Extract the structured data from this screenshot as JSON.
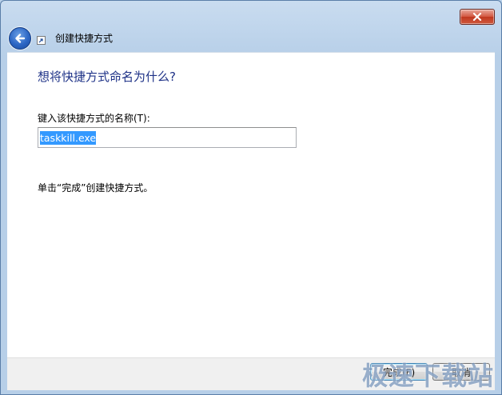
{
  "window": {
    "title": "创建快捷方式"
  },
  "nav": {
    "back_icon": "back-arrow-icon",
    "shortcut_icon": "shortcut-icon"
  },
  "page": {
    "heading": "想将快捷方式命名为什么?",
    "field_label": "键入该快捷方式的名称(T):",
    "field_value": "taskkill.exe",
    "hint": "单击“完成”创建快捷方式。"
  },
  "buttons": {
    "finish": "完成(F)",
    "cancel": "取消"
  },
  "watermark": "极速下载站",
  "colors": {
    "heading": "#1e3287",
    "selection": "#3399ff",
    "close": "#c0381f"
  }
}
